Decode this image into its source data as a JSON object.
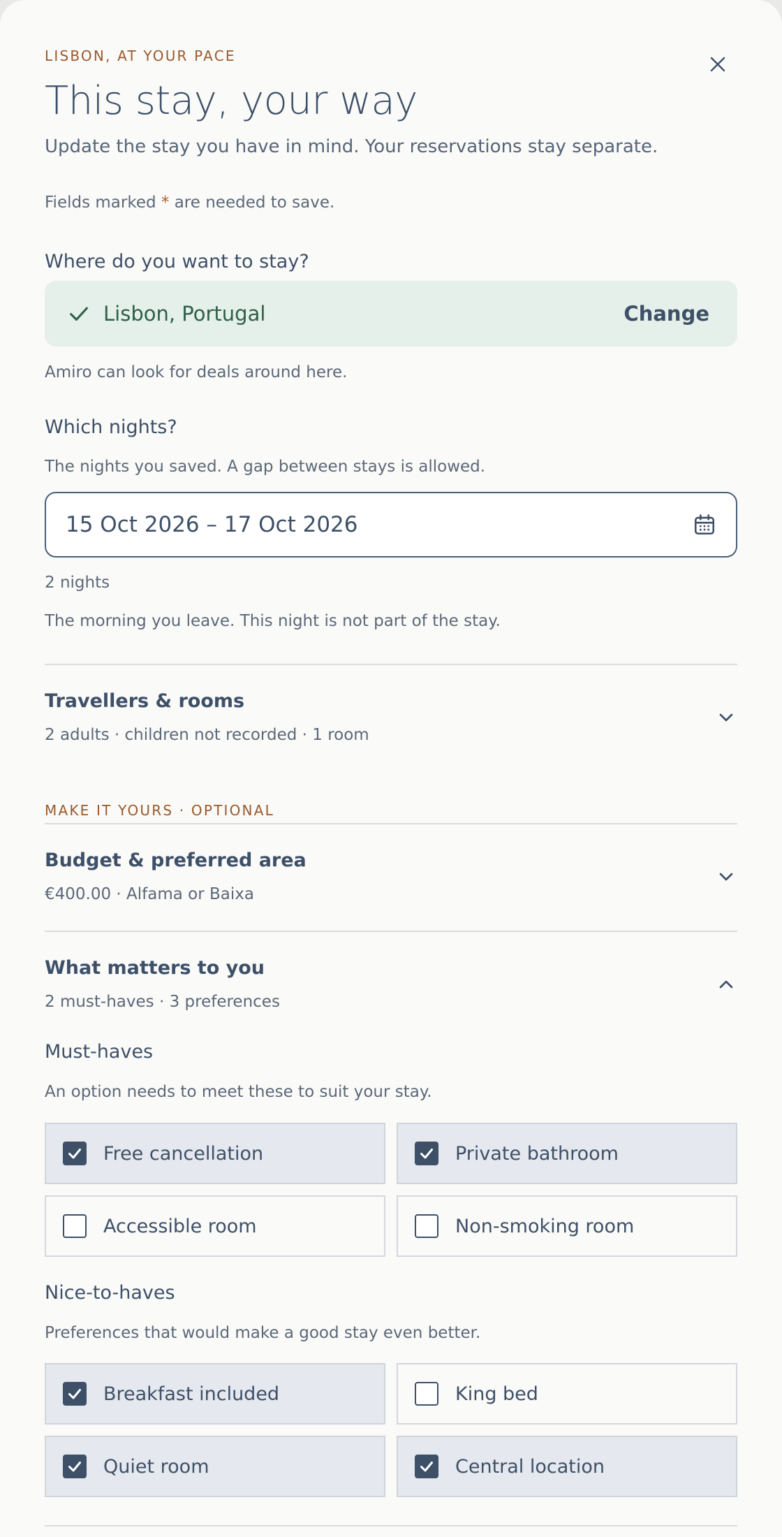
{
  "header": {
    "eyebrow": "LISBON, AT YOUR PACE",
    "title": "This stay, your way",
    "subtitle": "Update the stay you have in mind. Your reservations stay separate.",
    "required_prefix": "Fields marked ",
    "required_star": "*",
    "required_suffix": " are needed to save.",
    "close_icon": "close-icon"
  },
  "destination": {
    "label": "Where do you want to stay?",
    "value": "Lisbon, Portugal",
    "change_label": "Change",
    "hint": "Amiro can look for deals around here."
  },
  "dates": {
    "label": "Which nights?",
    "hint": "The nights you saved. A gap between stays is allowed.",
    "value": "15 Oct 2026 – 17 Oct 2026",
    "nights": "2 nights",
    "checkout_hint": "The morning you leave. This night is not part of the stay."
  },
  "travellers": {
    "title": "Travellers & rooms",
    "summary": "2 adults · children not recorded · 1 room"
  },
  "optional_section": {
    "eyebrow": "MAKE IT YOURS · OPTIONAL"
  },
  "budget": {
    "title": "Budget & preferred area",
    "summary": "€400.00 · Alfama or Baixa"
  },
  "matters": {
    "title": "What matters to you",
    "summary": "2 must-haves · 3 preferences",
    "must_haves": {
      "label": "Must-haves",
      "hint": "An option needs to meet these to suit your stay.",
      "options": [
        {
          "label": "Free cancellation",
          "checked": true
        },
        {
          "label": "Private bathroom",
          "checked": true
        },
        {
          "label": "Accessible room",
          "checked": false
        },
        {
          "label": "Non-smoking room",
          "checked": false
        }
      ]
    },
    "nice_to_haves": {
      "label": "Nice-to-haves",
      "hint": "Preferences that would make a good stay even better.",
      "options": [
        {
          "label": "Breakfast included",
          "checked": true
        },
        {
          "label": "King bed",
          "checked": false
        },
        {
          "label": "Quiet room",
          "checked": true
        },
        {
          "label": "Central location",
          "checked": true
        }
      ]
    }
  },
  "colors": {
    "accent": "#3e5068",
    "eyebrow": "#9a5a2c",
    "success_bg": "#e5f0ea",
    "success_text": "#2f6048"
  }
}
